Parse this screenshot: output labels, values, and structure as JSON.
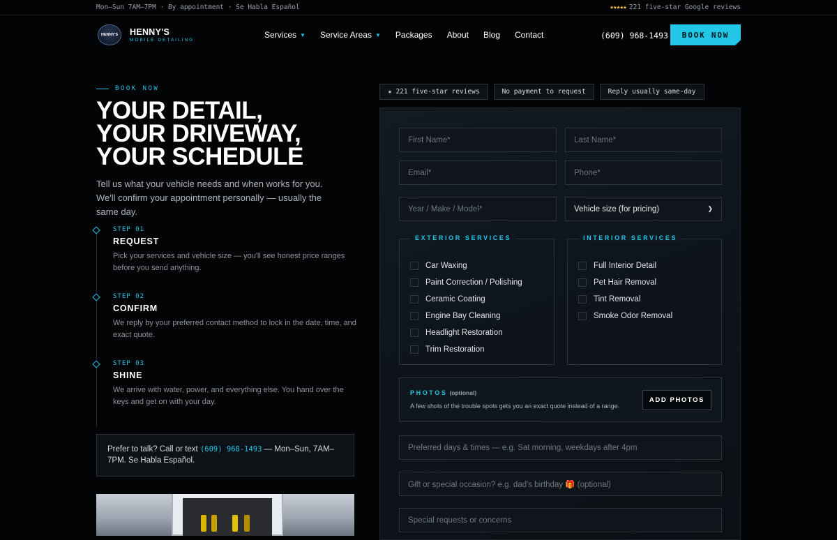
{
  "topbar": {
    "hours": "Mon–Sun 7AM–7PM · By appointment · Se Habla Español",
    "stars": "★★★★★",
    "reviews": "221 five-star Google reviews"
  },
  "nav": {
    "brand_line1": "HENNY'S",
    "brand_line2": "MOBILE DETAILING",
    "badge_text": "HENNY'S",
    "links": [
      {
        "label": "Services",
        "dropdown": true
      },
      {
        "label": "Service Areas",
        "dropdown": true
      },
      {
        "label": "Packages"
      },
      {
        "label": "About"
      },
      {
        "label": "Blog"
      },
      {
        "label": "Contact"
      }
    ],
    "phone": "(609) 968-1493",
    "cta": "BOOK NOW",
    "caret": "▼"
  },
  "hero": {
    "eyebrow": "BOOK NOW",
    "line1": "YOUR DETAIL,",
    "line2": "YOUR DRIVEWAY,",
    "line3": "YOUR SCHEDULE",
    "lede": "Tell us what your vehicle needs and when works for you. We'll confirm your appointment personally — usually the same day."
  },
  "steps": [
    {
      "num": "STEP 01",
      "title": "REQUEST",
      "desc": "Pick your services and vehicle size — you'll see honest price ranges before you send anything."
    },
    {
      "num": "STEP 02",
      "title": "CONFIRM",
      "desc": "We reply by your preferred contact method to lock in the date, time, and exact quote."
    },
    {
      "num": "STEP 03",
      "title": "SHINE",
      "desc": "We arrive with water, power, and everything else. You hand over the keys and get on with your day."
    }
  ],
  "call_box": {
    "prefix": "Prefer to talk? Call or text ",
    "phone": "(609) 968-1493",
    "suffix": " — Mon–Sun, 7AM–7PM. Se Habla Español."
  },
  "pills": [
    "★ 221 five-star reviews",
    "No payment to request",
    "Reply usually same-day"
  ],
  "form": {
    "first_name": "First Name*",
    "last_name": "Last Name*",
    "email": "Email*",
    "phone": "Phone*",
    "vehicle": "Year / Make / Model*",
    "vehicle_size": "Vehicle size (for pricing)",
    "exterior_title": "EXTERIOR SERVICES",
    "exterior": [
      "Car Waxing",
      "Paint Correction / Polishing",
      "Ceramic Coating",
      "Engine Bay Cleaning",
      "Headlight Restoration",
      "Trim Restoration"
    ],
    "interior_title": "INTERIOR SERVICES",
    "interior": [
      "Full Interior Detail",
      "Pet Hair Removal",
      "Tint Removal",
      "Smoke Odor Removal"
    ],
    "photos_title": "PHOTOS",
    "photos_optional": "(optional)",
    "photos_sub": "A few shots of the trouble spots gets you an exact quote instead of a range.",
    "photos_button": "ADD PHOTOS",
    "preferred_times": "Preferred days & times — e.g. Sat morning, weekdays after 4pm",
    "occasion": "Gift or special occasion? e.g. dad's birthday 🎁 (optional)",
    "special_requests": "Special requests or concerns"
  },
  "colors": {
    "accent": "#22c7e8",
    "background": "#030406",
    "panel": "#0f151b"
  }
}
